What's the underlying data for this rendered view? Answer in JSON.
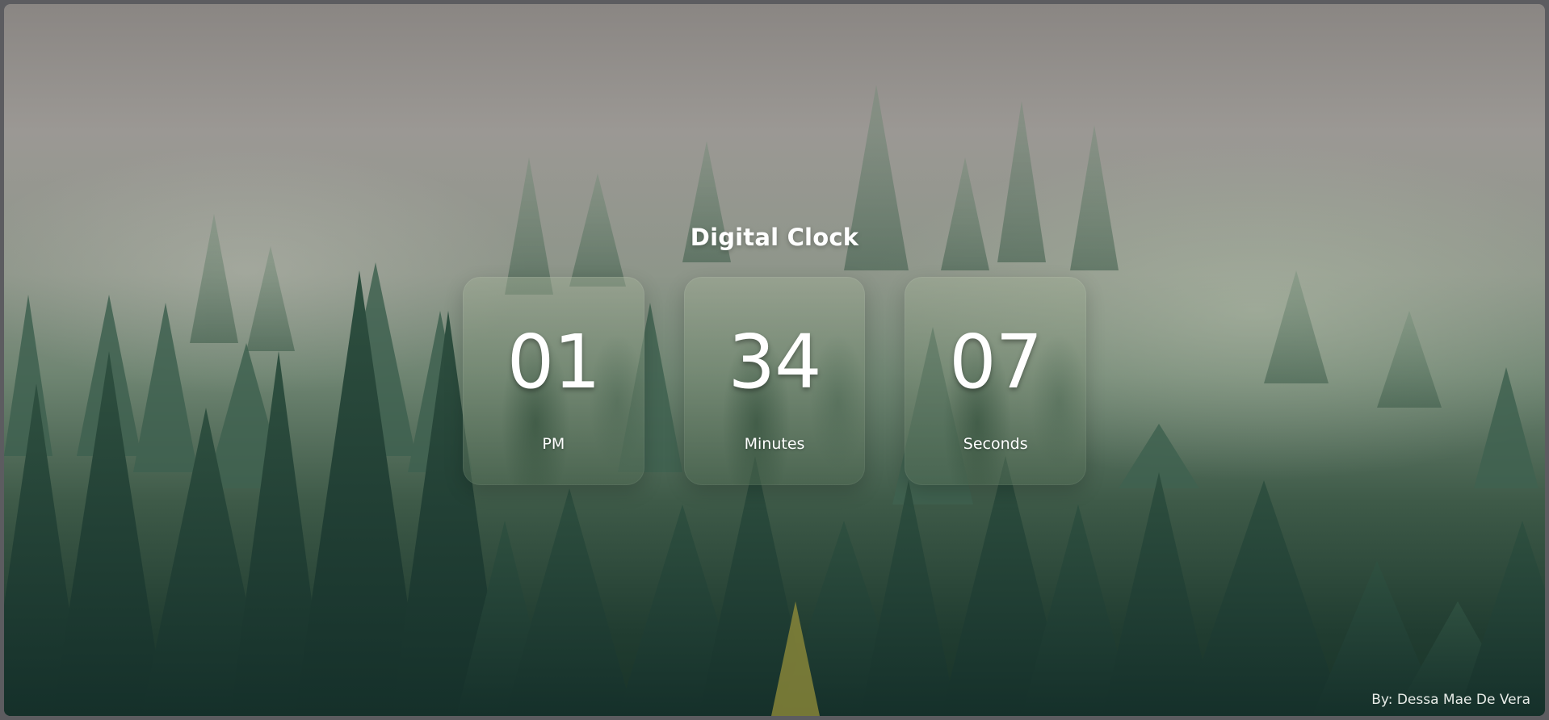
{
  "title": "Digital Clock",
  "clock": [
    {
      "value": "01",
      "label": "PM"
    },
    {
      "value": "34",
      "label": "Minutes"
    },
    {
      "value": "07",
      "label": "Seconds"
    }
  ],
  "credit": "By: Dessa Mae De Vera",
  "colors": {
    "text": "#ffffff",
    "card": "rgba(120,140,115,0.35)",
    "forest_dark": "#183227",
    "sky": "#8a8683"
  }
}
